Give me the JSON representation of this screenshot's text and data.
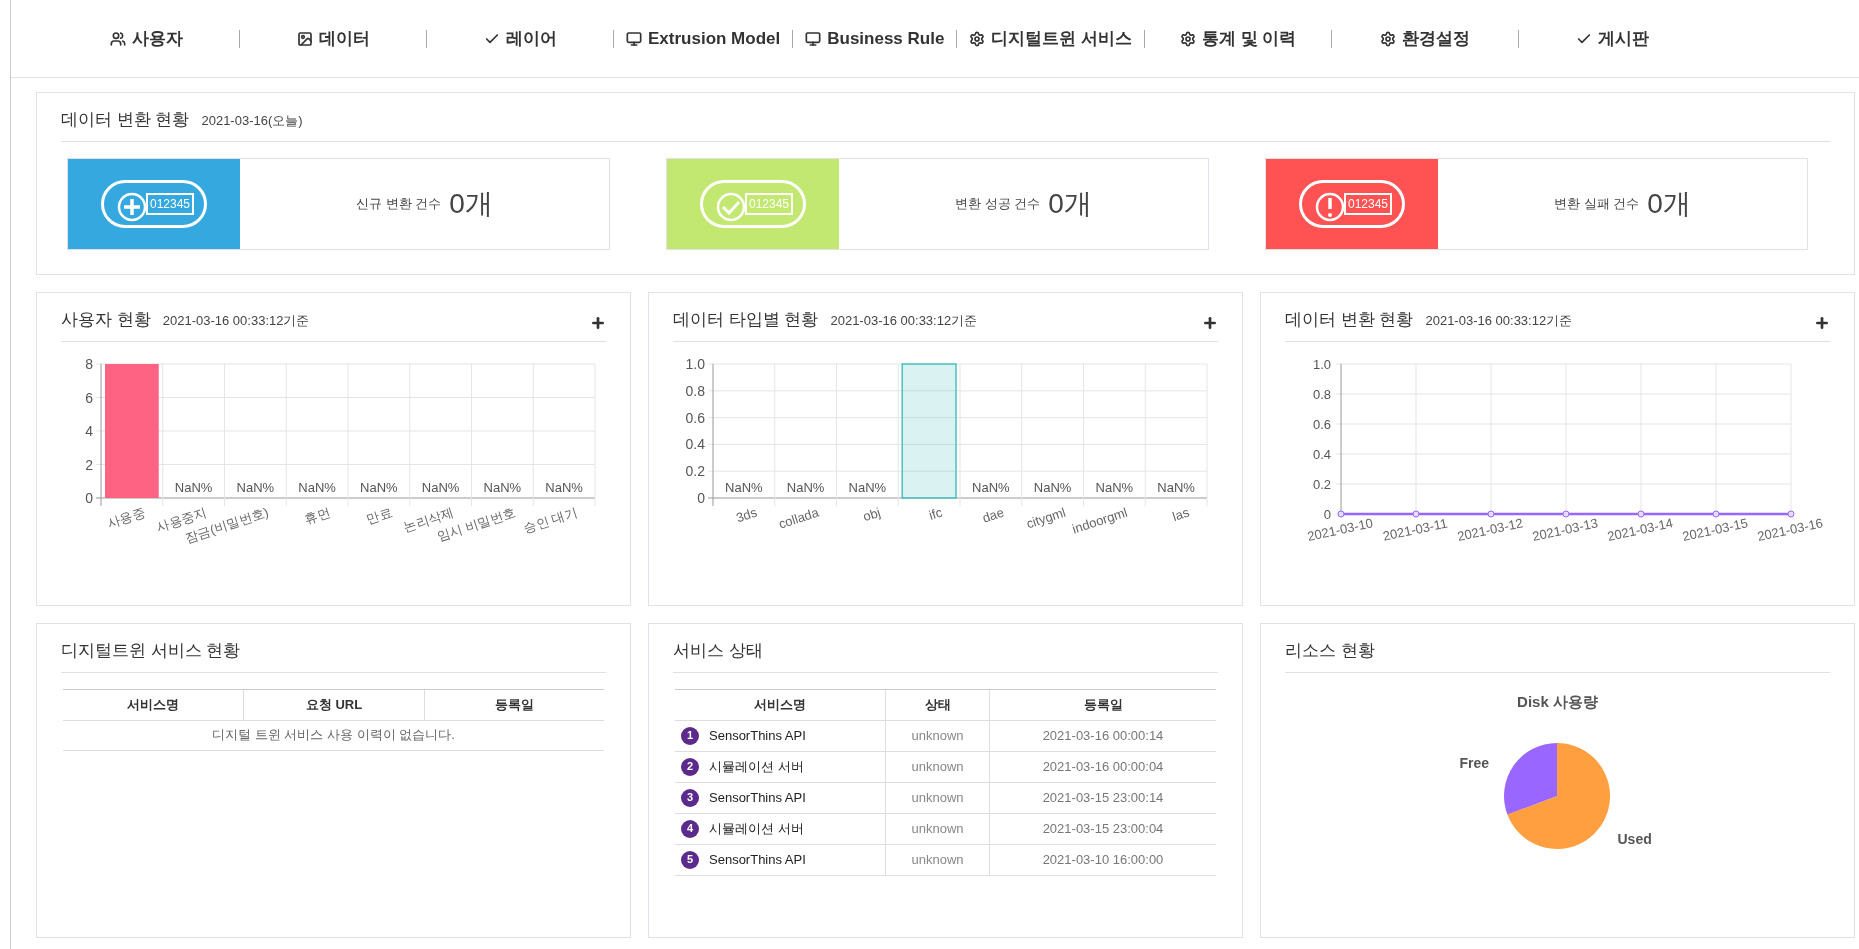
{
  "nav": [
    {
      "label": "사용자"
    },
    {
      "label": "데이터"
    },
    {
      "label": "레이어"
    },
    {
      "label": "Extrusion Model"
    },
    {
      "label": "Business Rule"
    },
    {
      "label": "디지털트윈 서비스"
    },
    {
      "label": "통계 및 이력"
    },
    {
      "label": "환경설정"
    },
    {
      "label": "게시판"
    }
  ],
  "conversion_summary": {
    "title": "데이터 변환 현황",
    "date": "2021-03-16(오늘)",
    "cards": [
      {
        "kind": "new",
        "color": "#35a8e0",
        "counter": "012345",
        "label": "신규 변환 건수",
        "count": "0개"
      },
      {
        "kind": "success",
        "color": "#c2e872",
        "counter": "012345",
        "label": "변환 성공 건수",
        "count": "0개"
      },
      {
        "kind": "fail",
        "color": "#ff5252",
        "counter": "012345",
        "label": "변환 실패 건수",
        "count": "0개"
      }
    ]
  },
  "charts": [
    {
      "title": "사용자 현황",
      "subtitle": "2021-03-16 00:33:12기준",
      "kind": "filled",
      "chart_data": {
        "type": "bar",
        "categories": [
          "사용중",
          "사용중지",
          "잠금(비밀번호)",
          "휴먼",
          "만료",
          "논리삭제",
          "임시 비밀번호",
          "승인 대기"
        ],
        "series": [
          {
            "color": "#ff6384",
            "values": [
              8,
              0,
              0,
              0,
              0,
              0,
              0,
              0
            ]
          }
        ],
        "ylim": [
          0,
          8
        ],
        "yticks": [
          0,
          2,
          4,
          6,
          8
        ],
        "value_labels": [
          null,
          "NaN%",
          "NaN%",
          "NaN%",
          "NaN%",
          "NaN%",
          "NaN%",
          "NaN%"
        ],
        "grid": true
      }
    },
    {
      "title": "데이터 타입별 현황",
      "subtitle": "2021-03-16 00:33:12기준",
      "kind": "outlined",
      "chart_data": {
        "type": "bar",
        "categories": [
          "3ds",
          "collada",
          "obj",
          "ifc",
          "dae",
          "citygml",
          "indoorgml",
          "las"
        ],
        "series": [
          {
            "color": "#4bc0c0",
            "values": [
              0,
              0,
              0,
              1,
              0,
              0,
              0,
              0
            ]
          }
        ],
        "ylim": [
          0,
          1
        ],
        "yticks": [
          0,
          0.2,
          0.4,
          0.6,
          0.8,
          {
            "value": 1,
            "label": "1.0"
          }
        ],
        "value_labels": [
          "NaN%",
          "NaN%",
          "NaN%",
          null,
          "NaN%",
          "NaN%",
          "NaN%",
          "NaN%"
        ],
        "grid": true
      }
    },
    {
      "title": "데이터 변환 현황",
      "subtitle": "2021-03-16 00:33:12기준",
      "chart_data": {
        "type": "line",
        "x": [
          "2021-03-10",
          "2021-03-11",
          "2021-03-12",
          "2021-03-13",
          "2021-03-14",
          "2021-03-15",
          "2021-03-16"
        ],
        "series": [
          {
            "color": "#9966ff",
            "values": [
              0,
              0,
              0,
              0,
              0,
              0,
              0
            ],
            "marker": true
          }
        ],
        "ylim": [
          0,
          1
        ],
        "yticks": [
          0,
          0.2,
          0.4,
          0.6,
          0.8,
          {
            "value": 1,
            "label": "1.0"
          }
        ],
        "grid": true
      }
    }
  ],
  "twin_services": {
    "title": "디지털트윈 서비스 현황",
    "columns": [
      "서비스명",
      "요청 URL",
      "등록일"
    ],
    "empty_message": "디지털 트윈 서비스 사용 이력이 없습니다."
  },
  "service_status": {
    "title": "서비스 상태",
    "columns": [
      "서비스명",
      "상태",
      "등록일"
    ],
    "rows": [
      {
        "number": "1",
        "name": "SensorThins API",
        "status": "unknown",
        "date": "2021-03-16 00:00:14"
      },
      {
        "number": "2",
        "name": "시뮬레이션 서버",
        "status": "unknown",
        "date": "2021-03-16 00:00:04"
      },
      {
        "number": "3",
        "name": "SensorThins API",
        "status": "unknown",
        "date": "2021-03-15 23:00:14"
      },
      {
        "number": "4",
        "name": "시뮬레이션 서버",
        "status": "unknown",
        "date": "2021-03-15 23:00:04"
      },
      {
        "number": "5",
        "name": "SensorThins API",
        "status": "unknown",
        "date": "2021-03-10 16:00:00"
      }
    ]
  },
  "resources": {
    "title": "리소스 현황",
    "pie_title": "Disk 사용량",
    "slices": [
      {
        "label": "Used",
        "color": "#ff9f40"
      },
      {
        "label": "Free",
        "color": "#9966ff"
      }
    ]
  }
}
